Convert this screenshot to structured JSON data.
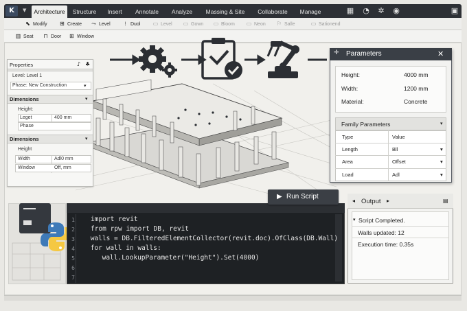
{
  "app": {
    "logo_text": "K"
  },
  "tabs": [
    {
      "label": "Architecture",
      "active": true
    },
    {
      "label": "Structure"
    },
    {
      "label": "Insert"
    },
    {
      "label": "Annotate"
    },
    {
      "label": "Analyze"
    },
    {
      "label": "Massing & Site"
    },
    {
      "label": "Collaborate"
    },
    {
      "label": "Manage"
    }
  ],
  "header_icons": [
    "grid-icon",
    "info-icon",
    "gear-icon",
    "user-icon",
    "window-icon"
  ],
  "toolbar": [
    {
      "label": "Modify",
      "icon": "cursor-icon",
      "enabled": true
    },
    {
      "label": "Create",
      "icon": "create-icon",
      "enabled": true
    },
    {
      "label": "Level",
      "icon": "level-icon",
      "enabled": true
    },
    {
      "label": "Duol",
      "icon": "dual-icon",
      "enabled": true
    },
    {
      "label": "Level",
      "icon": "level-icon",
      "enabled": false
    },
    {
      "label": "Gown",
      "icon": "gown-icon",
      "enabled": false
    },
    {
      "label": "Bloom",
      "icon": "bloom-icon",
      "enabled": false
    },
    {
      "label": "Neon",
      "icon": "neon-icon",
      "enabled": false
    },
    {
      "label": "Salle",
      "icon": "salle-icon",
      "enabled": false
    },
    {
      "label": "Sationend",
      "icon": "sationend-icon",
      "enabled": false
    }
  ],
  "subtoolbar": [
    {
      "label": "Seat",
      "icon": "seat-icon"
    },
    {
      "label": "Door",
      "icon": "door-icon"
    },
    {
      "label": "Window",
      "icon": "window-icon"
    }
  ],
  "properties": {
    "title": "Properties",
    "level": "Level: Level 1",
    "phase": "Phase: New Construction",
    "dim1": {
      "title": "Dimensions",
      "rows": [
        {
          "label": "Height:",
          "value": ""
        },
        {
          "label": "Leget",
          "value": "400 mm"
        },
        {
          "label": "Phase",
          "value": ""
        }
      ]
    },
    "dim2": {
      "title": "Dimensions",
      "rows": [
        {
          "label": "Height",
          "value": ""
        },
        {
          "label": "Width",
          "value": "Adl0 mm"
        },
        {
          "label": "Window",
          "value": "Off, mm"
        }
      ]
    }
  },
  "parameters": {
    "title": "Parameters",
    "fields": [
      {
        "label": "Height:",
        "value": "4000 mm"
      },
      {
        "label": "Width:",
        "value": "1200 mm"
      },
      {
        "label": "Material:",
        "value": "Concrete"
      }
    ],
    "family_title": "Family Parameters",
    "family_header": {
      "col1": "Type",
      "col2": "Value"
    },
    "family_rows": [
      {
        "name": "Length",
        "value": "Bll"
      },
      {
        "name": "Area",
        "value": "Offset"
      },
      {
        "name": "Load",
        "value": "Adl"
      }
    ]
  },
  "script": {
    "run_label": "Run Script",
    "lines": [
      {
        "n": "1",
        "code": "import revit"
      },
      {
        "n": "2",
        "code": "from rpw import DB, revit"
      },
      {
        "n": "3",
        "code": " walls = DB.FilteredElementCollector(revit.doc).OfClass(DB.Wall)"
      },
      {
        "n": "4",
        "code": " for wall in walls:"
      },
      {
        "n": "5",
        "code": "     wall.LookupParameter(\"Height\").Set(4000)"
      },
      {
        "n": "6",
        "code": ""
      },
      {
        "n": "7",
        "code": ""
      }
    ]
  },
  "output": {
    "title": "Output",
    "lines": [
      "Script Completed.",
      "Walls updated:  12",
      "Execution time:  0.35s"
    ]
  },
  "colors": {
    "dark": "#2d3035",
    "accent": "#3b4a60",
    "code_bg": "#1e2124"
  }
}
